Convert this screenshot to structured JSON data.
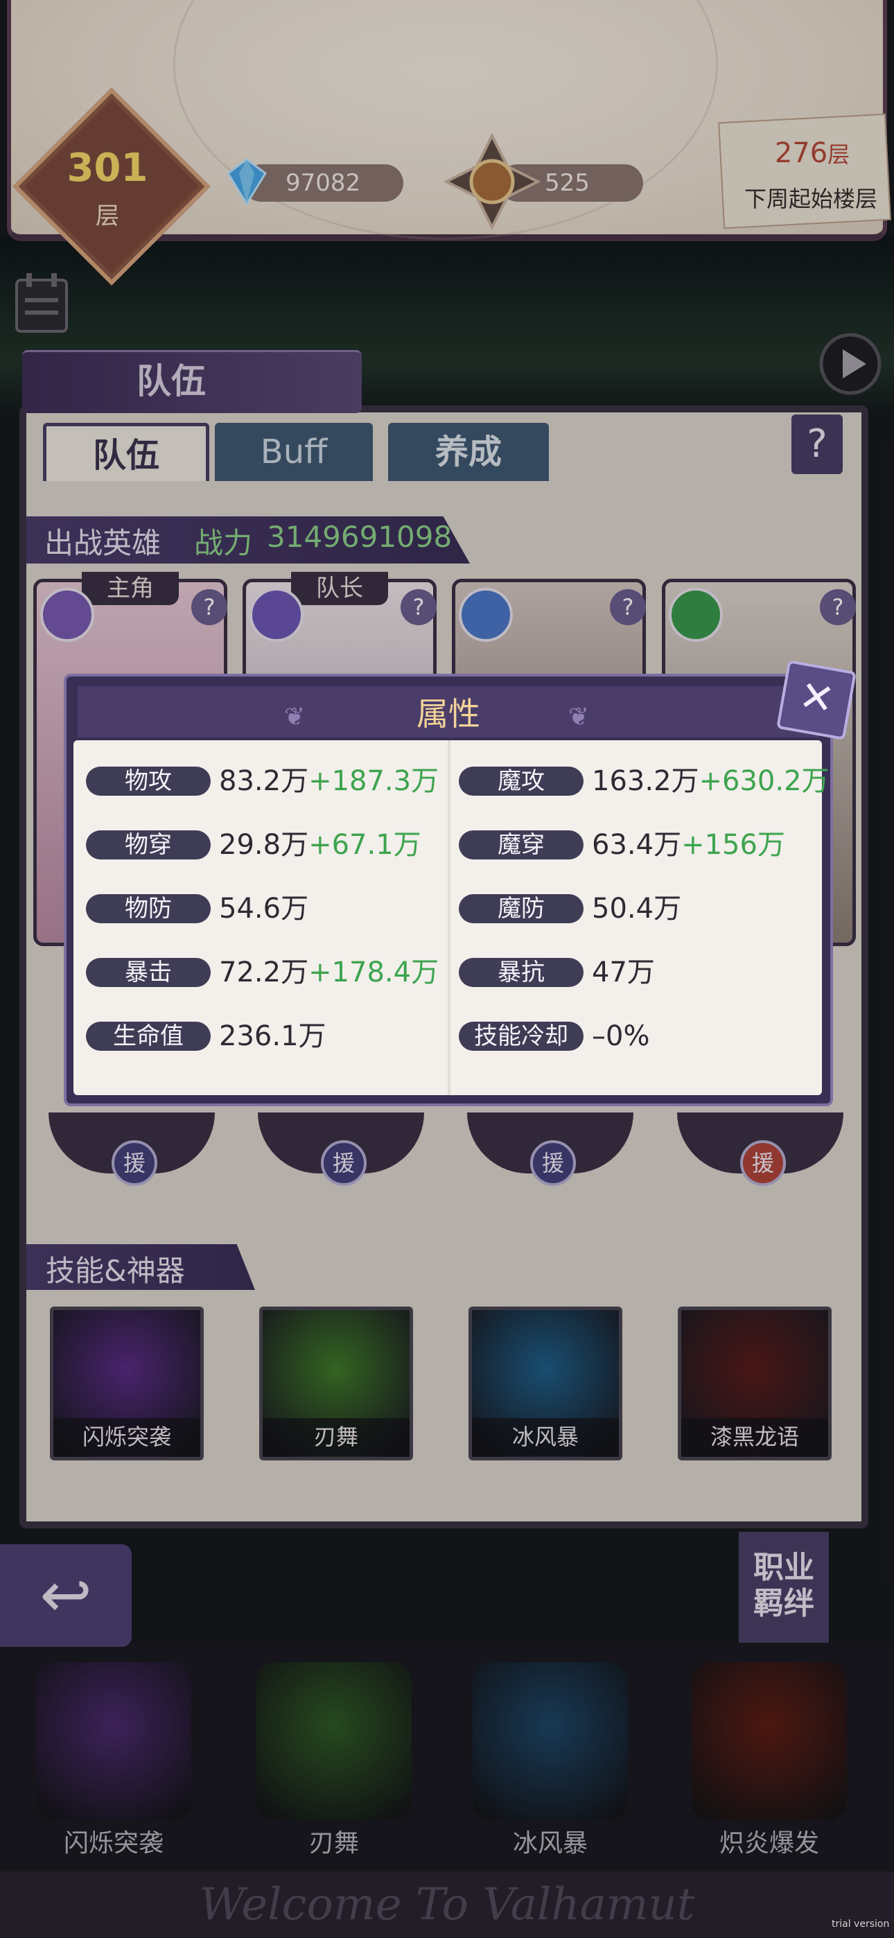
{
  "header": {
    "floor_number": "301",
    "floor_unit": "层",
    "diamonds": "97082",
    "medals": "525",
    "next_floor_number": "276",
    "next_floor_unit": "层",
    "next_floor_label": "下周起始楼层"
  },
  "team": {
    "banner_title": "队伍",
    "tabs": [
      "队伍",
      "Buff",
      "养成"
    ],
    "help": "?",
    "heroes_label": "出战英雄",
    "power_label": "战力",
    "power_value": "3149691098",
    "hero_tags": [
      "主角",
      "队长"
    ],
    "class_colors": [
      "#7a5bb0",
      "#6e57b5",
      "#4d78c9",
      "#3a9a4e"
    ],
    "support_label": "援",
    "support_colors": [
      "#45407a",
      "#45407a",
      "#45407a",
      "#b0453a"
    ]
  },
  "skills": {
    "header": "技能&神器",
    "items": [
      "闪烁突袭",
      "刃舞",
      "冰风暴",
      "漆黑龙语"
    ],
    "colors": [
      "#5a2c86",
      "#3f7a2a",
      "#1f5f8a",
      "#5a1c1c"
    ]
  },
  "bottom": {
    "bond_button": [
      "职业",
      "羁绊"
    ],
    "skills": [
      "闪烁突袭",
      "刃舞",
      "冰风暴",
      "炽炎爆发"
    ],
    "skill_colors": [
      "#4b2a6e",
      "#2f5a26",
      "#1e4668",
      "#5e1d14"
    ],
    "welcome": "Welcome To Valhamut",
    "trial": "trial version"
  },
  "attributes": {
    "title": "属性",
    "left": [
      {
        "label": "物攻",
        "value": "83.2万",
        "bonus": "+187.3万"
      },
      {
        "label": "物穿",
        "value": "29.8万",
        "bonus": "+67.1万"
      },
      {
        "label": "物防",
        "value": "54.6万",
        "bonus": ""
      },
      {
        "label": "暴击",
        "value": "72.2万",
        "bonus": "+178.4万"
      },
      {
        "label": "生命值",
        "value": "236.1万",
        "bonus": ""
      }
    ],
    "right": [
      {
        "label": "魔攻",
        "value": "163.2万",
        "bonus": "+630.2万"
      },
      {
        "label": "魔穿",
        "value": "63.4万",
        "bonus": "+156万"
      },
      {
        "label": "魔防",
        "value": "50.4万",
        "bonus": ""
      },
      {
        "label": "暴抗",
        "value": "47万",
        "bonus": ""
      },
      {
        "label": "技能冷却",
        "value": "–0%",
        "bonus": ""
      }
    ]
  }
}
